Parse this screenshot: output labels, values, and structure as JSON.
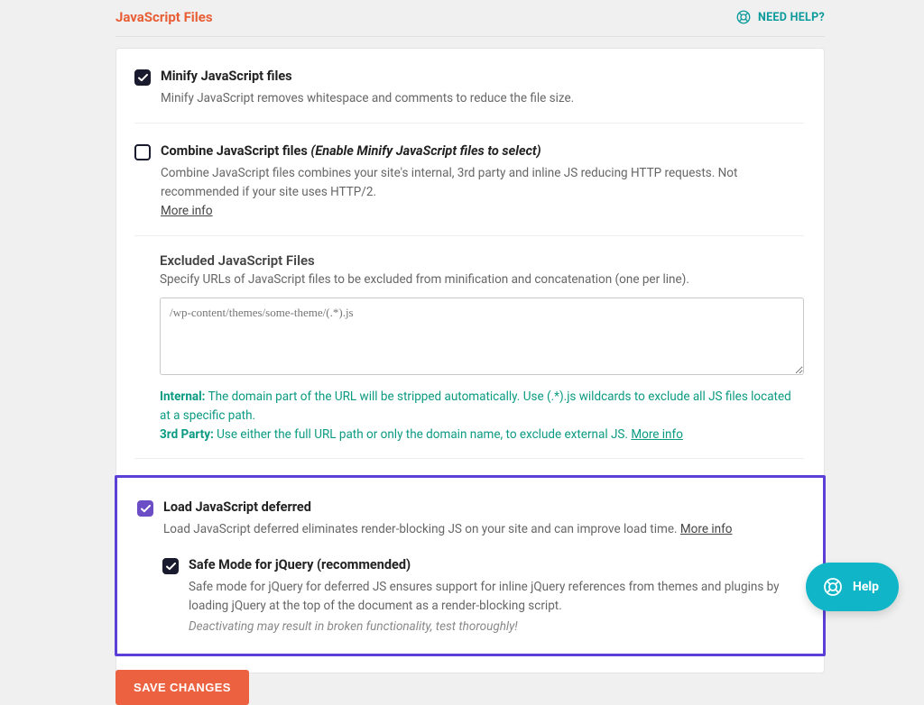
{
  "header": {
    "title": "JavaScript Files",
    "help": "NEED HELP?"
  },
  "settings": {
    "minify": {
      "label": "Minify JavaScript files",
      "desc": "Minify JavaScript removes whitespace and comments to reduce the file size."
    },
    "combine": {
      "label": "Combine JavaScript files",
      "hint": "(Enable Minify JavaScript files to select)",
      "desc": "Combine JavaScript files combines your site's internal, 3rd party and inline JS reducing HTTP requests. Not recommended if your site uses HTTP/2.",
      "more": "More info"
    },
    "excluded": {
      "title": "Excluded JavaScript Files",
      "sub": "Specify URLs of JavaScript files to be excluded from minification and concatenation (one per line).",
      "placeholder": "/wp-content/themes/some-theme/(.*).js",
      "note_internal_label": "Internal:",
      "note_internal_text": " The domain part of the URL will be stripped automatically. Use (.*).js wildcards to exclude all JS files located at a specific path.",
      "note_3rd_label": "3rd Party:",
      "note_3rd_text": " Use either the full URL path or only the domain name, to exclude external JS. ",
      "more": "More info"
    },
    "defer": {
      "label": "Load JavaScript deferred",
      "desc": "Load JavaScript deferred eliminates render-blocking JS on your site and can improve load time. ",
      "more": "More info"
    },
    "safemode": {
      "label": "Safe Mode for jQuery (recommended)",
      "desc": "Safe mode for jQuery for deferred JS ensures support for inline jQuery references from themes and plugins by loading jQuery at the top of the document as a render-blocking script.",
      "warn": "Deactivating may result in broken functionality, test thoroughly!"
    }
  },
  "actions": {
    "save": "SAVE CHANGES"
  },
  "widget": {
    "help": "Help"
  }
}
